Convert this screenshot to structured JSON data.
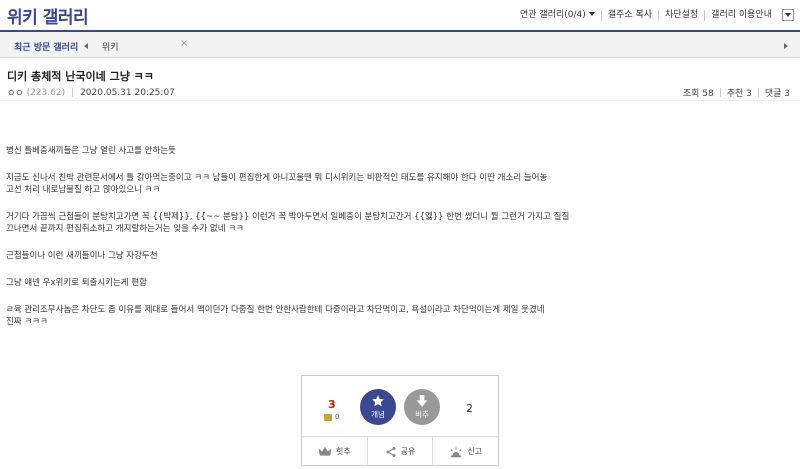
{
  "header": {
    "title": "위키 갤러리",
    "menu": {
      "related": "연관 갤러리(0/4)",
      "copy_address": "갤주소 복사",
      "block_settings": "차단설정",
      "guide": "갤러리 이용안내"
    }
  },
  "recent": {
    "label": "최근 방문 갤러리",
    "items": [
      "위키"
    ],
    "close": "×"
  },
  "post": {
    "title": "디키 총체적 난국이네 그냥 ㅋㅋ",
    "author": "ㅇㅇ",
    "ip": "(223.62)",
    "date": "2020.05.31 20:25:07",
    "views": "조회 58",
    "recommends": "추천 3",
    "comments": "댓글 3",
    "body": [
      "병신 틀베충새끼들은 그냥 열린 사고를 안하는듯",
      "",
      "지금도 신나서 친박 관련문서에서 틀 갉아먹는중이고 ㅋㅋ 남들이 편집한게 아니꼬울땐 뭐 디시위키는 비판적인 태도를 유지해야 한다 이딴 개소리 늘어놓",
      "고선 처리 내로남불질 하고 앉아있으니 ㅋㅋ",
      "",
      "거기다 가끔씩 근첩들이 분탕치고가면 꼭 {{박제}}, {{~~ 분탕}} 이런거 꼭 박아두면서 일베충이 분탕치고간거 {{엟}} 한번 썼더니 뭘 그런거 가지고 질질",
      "끄나면서 끝까지 편집취소하고 개지랄하는거는 잊을 수가 없네 ㅋㅋ",
      "",
      "근첩들이나 이런 새끼들이나 그냥 자강두천",
      "",
      "그냥 얘넨 우x위키로 퇴출시키는게 편함",
      "",
      "ㄹ육 관리조무사놈은 차단도 좀 이유를 제대로 들어서 맥이던가 다중질 한번 안한사람한테 다중이라고 차단먹이고, 욕설이라고 차단먹이는게 제일 웃겼네",
      "진짜 ㅋㅋㅋ"
    ]
  },
  "vote": {
    "up_count": "3",
    "fix_count": "0",
    "up_label": "개념",
    "down_label": "비추",
    "down_count": "2",
    "actions": {
      "best": "힛추",
      "share": "공유",
      "report": "신고"
    }
  },
  "colors": {
    "brand": "#3b4890",
    "up_count": "#d31900",
    "down_button": "#999999"
  }
}
